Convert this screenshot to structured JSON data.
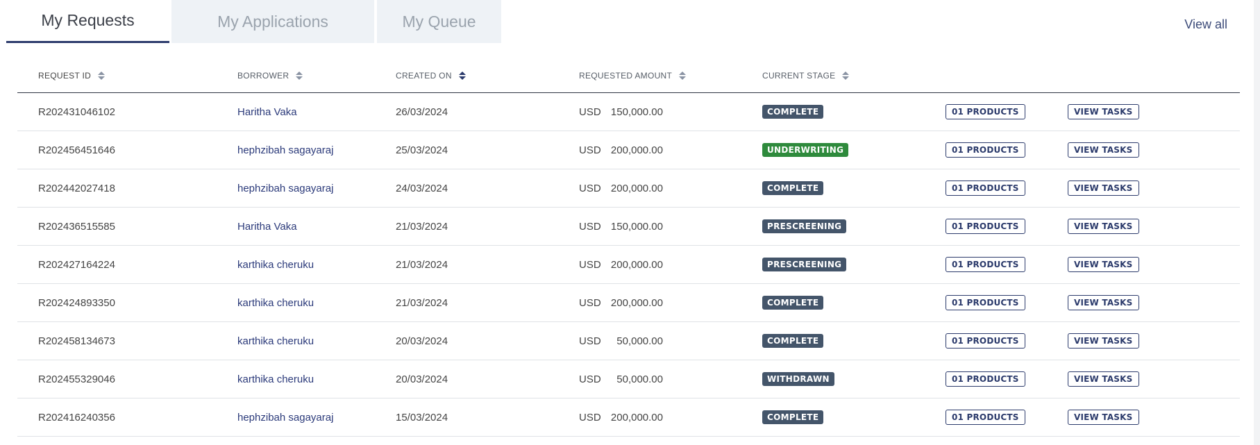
{
  "tabs": [
    {
      "label": "My Requests",
      "active": true
    },
    {
      "label": "My Applications",
      "active": false
    },
    {
      "label": "My Queue",
      "active": false
    }
  ],
  "view_all": "View all",
  "columns": {
    "request_id": "REQUEST ID",
    "borrower": "BORROWER",
    "created_on": "CREATED ON",
    "requested_amount": "REQUESTED AMOUNT",
    "current_stage": "CURRENT STAGE"
  },
  "rows": [
    {
      "id": "R202431046102",
      "borrower": "Haritha Vaka",
      "date": "26/03/2024",
      "currency": "USD",
      "amount": "150,000.00",
      "stage": "COMPLETE",
      "stage_key": "complete",
      "products": "01 PRODUCTS",
      "tasks": "VIEW TASKS"
    },
    {
      "id": "R202456451646",
      "borrower": "hephzibah sagayaraj",
      "date": "25/03/2024",
      "currency": "USD",
      "amount": "200,000.00",
      "stage": "UNDERWRITING",
      "stage_key": "underwriting",
      "products": "01 PRODUCTS",
      "tasks": "VIEW TASKS"
    },
    {
      "id": "R202442027418",
      "borrower": "hephzibah sagayaraj",
      "date": "24/03/2024",
      "currency": "USD",
      "amount": "200,000.00",
      "stage": "COMPLETE",
      "stage_key": "complete",
      "products": "01 PRODUCTS",
      "tasks": "VIEW TASKS"
    },
    {
      "id": "R202436515585",
      "borrower": "Haritha Vaka",
      "date": "21/03/2024",
      "currency": "USD",
      "amount": "150,000.00",
      "stage": "PRESCREENING",
      "stage_key": "prescreening",
      "products": "01 PRODUCTS",
      "tasks": "VIEW TASKS"
    },
    {
      "id": "R202427164224",
      "borrower": "karthika cheruku",
      "date": "21/03/2024",
      "currency": "USD",
      "amount": "200,000.00",
      "stage": "PRESCREENING",
      "stage_key": "prescreening",
      "products": "01 PRODUCTS",
      "tasks": "VIEW TASKS"
    },
    {
      "id": "R202424893350",
      "borrower": "karthika cheruku",
      "date": "21/03/2024",
      "currency": "USD",
      "amount": "200,000.00",
      "stage": "COMPLETE",
      "stage_key": "complete",
      "products": "01 PRODUCTS",
      "tasks": "VIEW TASKS"
    },
    {
      "id": "R202458134673",
      "borrower": "karthika cheruku",
      "date": "20/03/2024",
      "currency": "USD",
      "amount": "50,000.00",
      "stage": "COMPLETE",
      "stage_key": "complete",
      "products": "01 PRODUCTS",
      "tasks": "VIEW TASKS"
    },
    {
      "id": "R202455329046",
      "borrower": "karthika cheruku",
      "date": "20/03/2024",
      "currency": "USD",
      "amount": "50,000.00",
      "stage": "WITHDRAWN",
      "stage_key": "withdrawn",
      "products": "01 PRODUCTS",
      "tasks": "VIEW TASKS"
    },
    {
      "id": "R202416240356",
      "borrower": "hephzibah sagayaraj",
      "date": "15/03/2024",
      "currency": "USD",
      "amount": "200,000.00",
      "stage": "COMPLETE",
      "stage_key": "complete",
      "products": "01 PRODUCTS",
      "tasks": "VIEW TASKS"
    }
  ]
}
